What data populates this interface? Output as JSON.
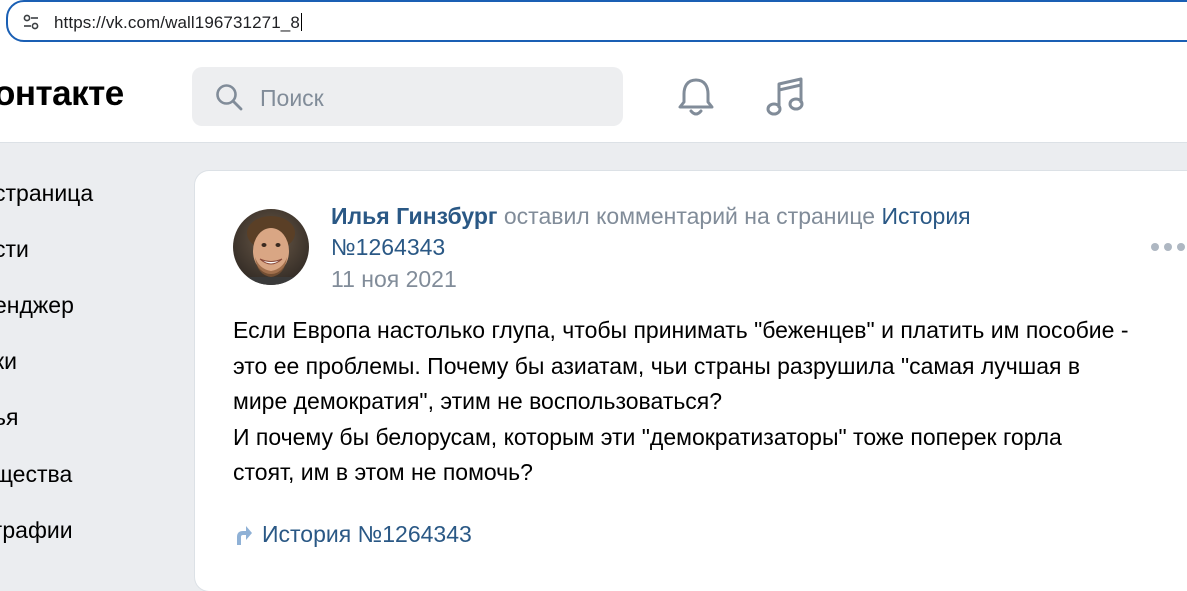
{
  "browser": {
    "url": "https://vk.com/wall196731271_8"
  },
  "header": {
    "logo_text": "онтакте",
    "search_placeholder": "Поиск"
  },
  "sidebar": {
    "items": [
      {
        "label": "страница"
      },
      {
        "label": "сти"
      },
      {
        "label": "енджер"
      },
      {
        "label": "ки"
      },
      {
        "label": "ья"
      },
      {
        "label": "щества"
      },
      {
        "label": "графии"
      }
    ]
  },
  "post": {
    "author": "Илья Гинзбург",
    "action": "оставил комментарий на странице",
    "target_line1": "История",
    "target_line2": "№1264343",
    "date": "11 ноя 2021",
    "text_lines": [
      "Если Европа настолько глупа, чтобы принимать \"беженцев\" и платить им пособие -",
      "это ее проблемы. Почему бы азиатам, чьи страны разрушила \"самая лучшая в",
      "мире демократия\", этим не воспользоваться?",
      "И почему бы белорусам, которым эти \"демократизаторы\" тоже поперек горла",
      "стоят, им в этом не помочь?"
    ],
    "attachment_label": "История №1264343"
  }
}
